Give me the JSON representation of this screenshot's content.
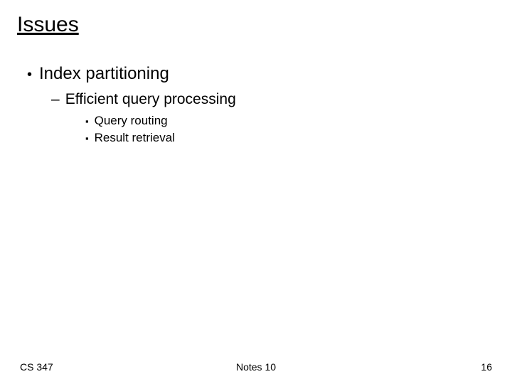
{
  "title": "Issues",
  "bullets": {
    "l1": "Index partitioning",
    "l2": "Efficient query processing",
    "l3a": "Query routing",
    "l3b": "Result retrieval"
  },
  "footer": {
    "left": "CS 347",
    "center": "Notes 10",
    "right": "16"
  }
}
